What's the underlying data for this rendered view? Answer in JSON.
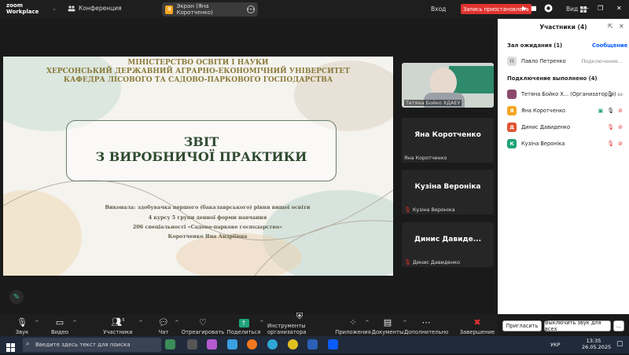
{
  "app": {
    "logo_line1": "zoom",
    "logo_line2": "Workplace",
    "menu_chevron": "⌄"
  },
  "topbar": {
    "meeting_label": "Конференция",
    "share_badge": "Я",
    "share_label": "Экран (Яна Коротченко)",
    "login": "Вход",
    "recording_label": "Запись приостановлена",
    "view_label": "Вид"
  },
  "slide": {
    "header1": "МІНІСТЕРСТВО ОСВІТИ І НАУКИ",
    "header2": "ХЕРСОНСЬКИЙ ДЕРЖАВНИЙ АГРАРНО-ЕКОНОМІЧНИЙ УНІВЕРСИТЕТ",
    "header3": "КАФЕДРА ЛІСОВОГО ТА САДОВО-ПАРКОВОГО ГОСПОДАРСТВА",
    "title1": "ЗВІТ",
    "title2": "З ВИРОБНИЧОЇ ПРАКТИКИ",
    "credit1": "Виконала: здобувачка першого (бакалаврського) рівня вищої освіти",
    "credit2": "4 курсу 5 групи денної форми навчання",
    "credit3": "206 спеціальності «Садово-паркове господарство»",
    "credit4": "Коротченко Яна Андріївна"
  },
  "gallery": [
    {
      "name": "",
      "label": "Тетяна Бойко ХДАЕУ",
      "muted": false
    },
    {
      "name": "Яна Коротченко",
      "label": "Яна Коротченко",
      "muted": false
    },
    {
      "name": "Кузіна Вероніка",
      "label": "Кузіна Вероніка",
      "muted": true
    },
    {
      "name": "Динис Давиде...",
      "label": "Динис Давиденко",
      "muted": true
    }
  ],
  "panel": {
    "title": "Участники (4)",
    "waiting_header": "Зал ожидания (1)",
    "waiting_action": "Сообщение",
    "waiting": {
      "avatar": "П",
      "name": "Павло Петренко",
      "status": "Подключение..."
    },
    "connected_header": "Подключение выполнено (4)",
    "participants": [
      {
        "avatar": "",
        "name": "Тетяна Бойко Х...  (Организатор, я)",
        "color": "#8b4a6b",
        "mic": "on",
        "video": "on"
      },
      {
        "avatar": "Я",
        "name": "Яна Коротченко",
        "color": "#f4a623",
        "mic": "on",
        "video": "off"
      },
      {
        "avatar": "Д",
        "name": "Динис Давиденко",
        "color": "#e0532f",
        "mic": "off",
        "video": "off"
      },
      {
        "avatar": "К",
        "name": "Кузіна Вероніка",
        "color": "#1fa37a",
        "mic": "off",
        "video": "off"
      }
    ],
    "invite_button": "Пригласить",
    "mute_all_button": "Выключить звук для всех",
    "more_button": "..."
  },
  "toolbar": {
    "audio": "Звук",
    "video": "Видео",
    "participants": "Участники",
    "participants_count": "5",
    "chat": "Чат",
    "react": "Отреагировать",
    "share": "Поделиться",
    "host_tools": "Инструменты организатора",
    "apps": "Приложения",
    "docs": "Документы",
    "more": "Дополнительно",
    "end": "Завершение"
  },
  "taskbar": {
    "search_placeholder": "Введите здесь текст для поиска",
    "lang": "УКР",
    "time": "13:35",
    "date": "26.05.2025"
  },
  "colors": {
    "accent": "#0b5cff",
    "record": "#e0332f",
    "share_green": "#1fa37a"
  }
}
